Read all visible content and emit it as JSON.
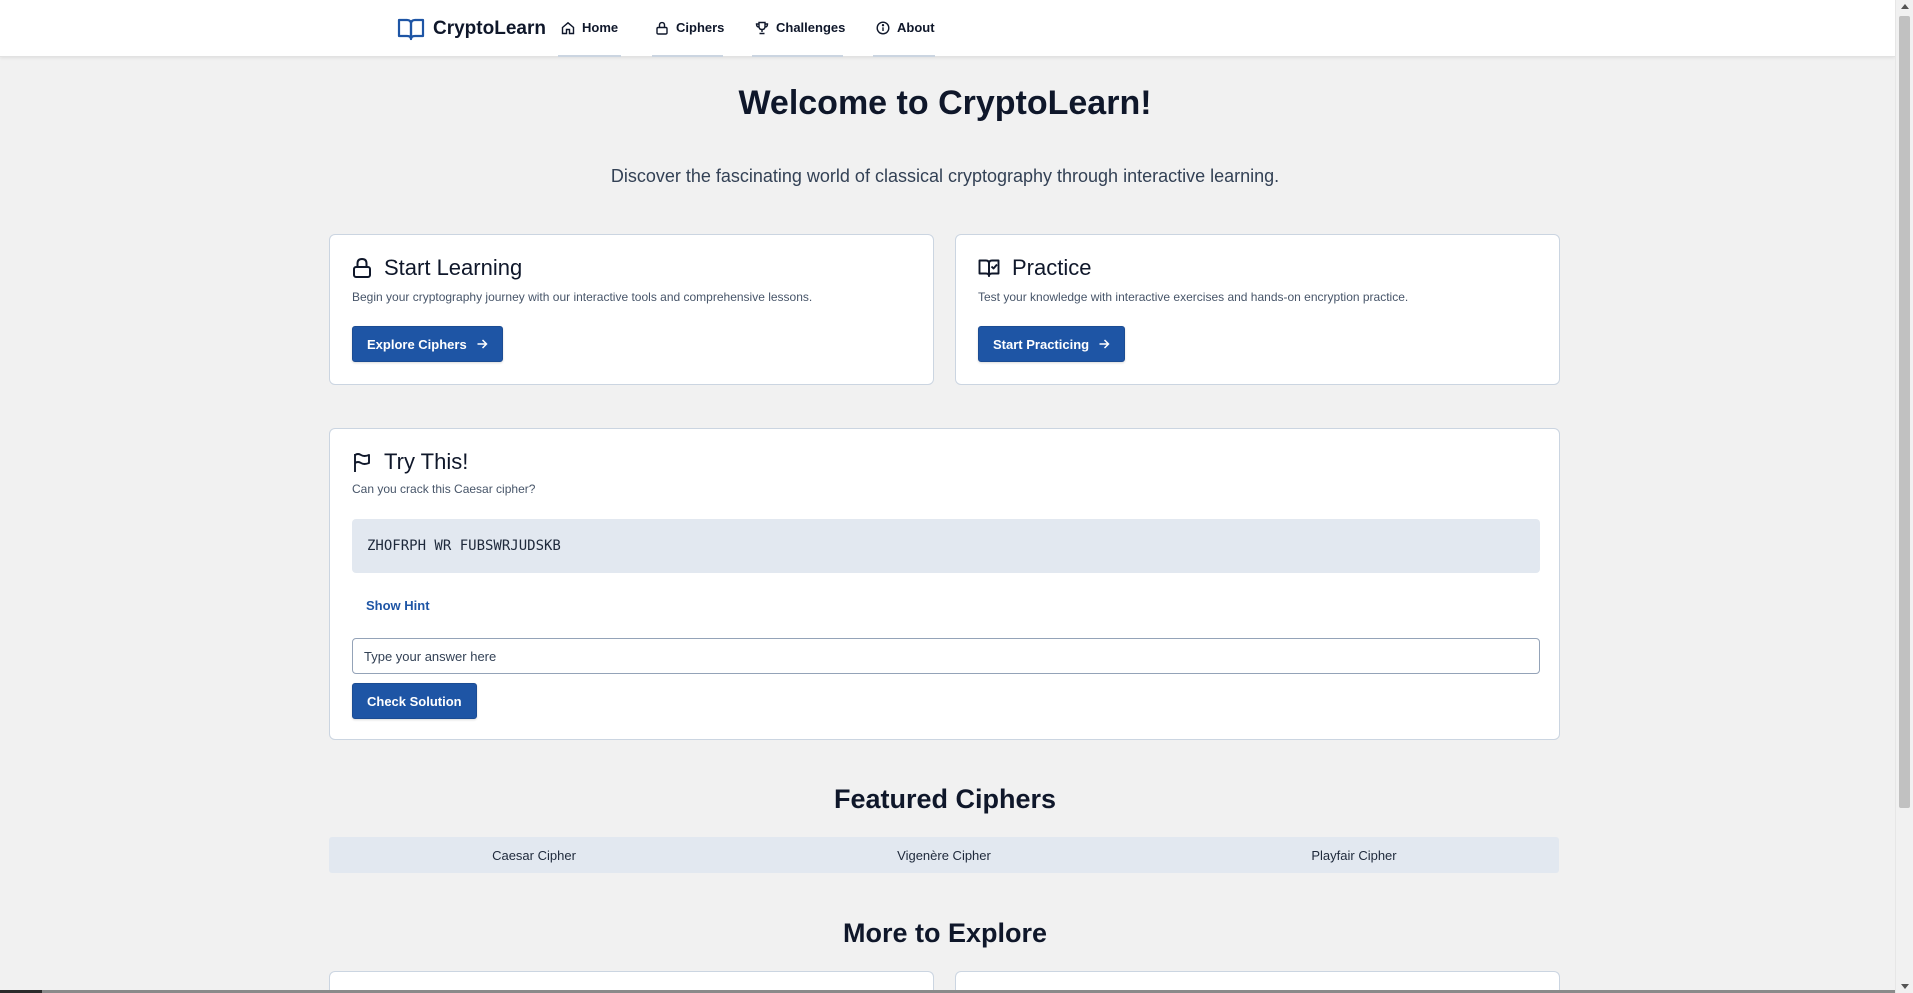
{
  "app": {
    "brand": "CryptoLearn"
  },
  "nav": {
    "items": [
      {
        "label": "Home",
        "icon": "home-icon"
      },
      {
        "label": "Ciphers",
        "icon": "lock-icon"
      },
      {
        "label": "Challenges",
        "icon": "trophy-icon"
      },
      {
        "label": "About",
        "icon": "info-icon"
      }
    ]
  },
  "hero": {
    "title": "Welcome to CryptoLearn!",
    "subtitle": "Discover the fascinating world of classical cryptography through interactive learning."
  },
  "cards": {
    "start_learning": {
      "title": "Start Learning",
      "description": "Begin your cryptography journey with our interactive tools and comprehensive lessons.",
      "button": "Explore Ciphers",
      "icon": "lock-icon"
    },
    "practice": {
      "title": "Practice",
      "description": "Test your knowledge with interactive exercises and hands-on encryption practice.",
      "button": "Start Practicing",
      "icon": "book-check-icon"
    }
  },
  "try_this": {
    "title": "Try This!",
    "description": "Can you crack this Caesar cipher?",
    "ciphertext": "ZHOFRPH WR FUBSWRJUDSKB",
    "hint_label": "Show Hint",
    "answer_placeholder": "Type your answer here",
    "answer_value": "",
    "check_button": "Check Solution",
    "icon": "flag-icon"
  },
  "featured": {
    "title": "Featured Ciphers",
    "tabs": [
      "Caesar Cipher",
      "Vigenère Cipher",
      "Playfair Cipher"
    ]
  },
  "more": {
    "title": "More to Explore"
  },
  "colors": {
    "primary": "#1e55a5",
    "page_bg": "#f1f1f1",
    "card_border": "#cbd5e1",
    "text": "#0f172a"
  }
}
